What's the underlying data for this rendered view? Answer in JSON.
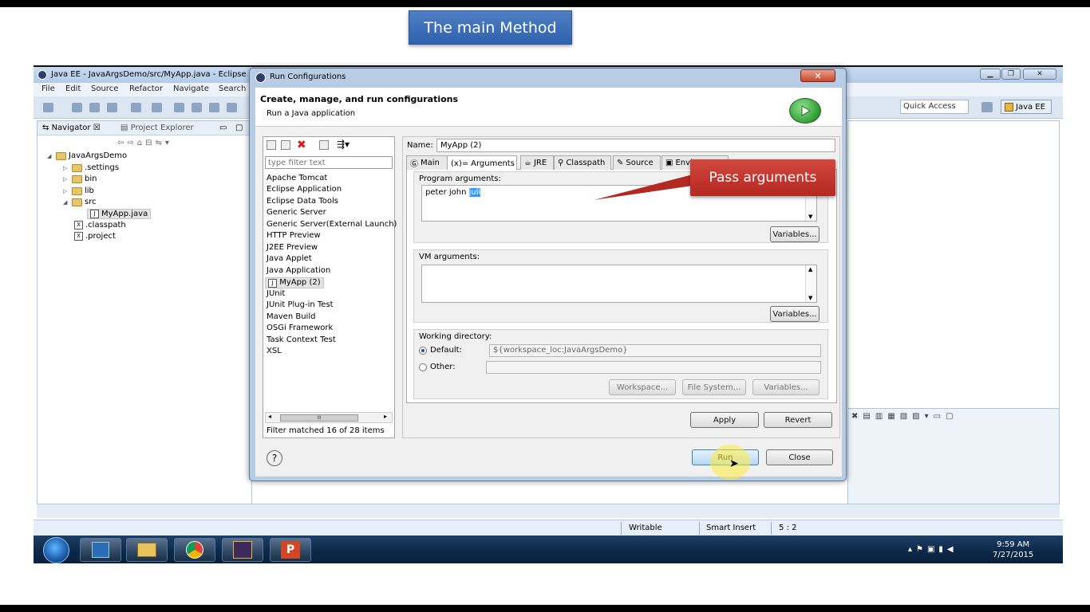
{
  "slide": {
    "title": "The main Method",
    "callout": "Pass arguments"
  },
  "eclipse": {
    "window_title": "Java EE - JavaArgsDemo/src/MyApp.java - Eclipse",
    "menu": [
      "File",
      "Edit",
      "Source",
      "Refactor",
      "Navigate",
      "Search"
    ],
    "quick_access": "Quick Access",
    "perspective": "Java EE",
    "panel_tabs": {
      "navigator": "Navigator",
      "project_explorer": "Project Explorer"
    },
    "tree": [
      {
        "label": "JavaArgsDemo"
      },
      {
        "label": ".settings"
      },
      {
        "label": "bin"
      },
      {
        "label": "lib"
      },
      {
        "label": "src"
      },
      {
        "label": "MyApp.java"
      },
      {
        "label": ".classpath"
      },
      {
        "label": ".project"
      }
    ],
    "status": {
      "writable": "Writable",
      "insert_mode": "Smart Insert",
      "position": "5 : 2"
    }
  },
  "dialog": {
    "title": "Run Configurations",
    "header_title": "Create, manage, and run configurations",
    "header_sub": "Run a Java application",
    "filter_placeholder": "type filter text",
    "configs": [
      "Apache Tomcat",
      "Eclipse Application",
      "Eclipse Data Tools",
      "Generic Server",
      "Generic Server(External Launch)",
      "HTTP Preview",
      "J2EE Preview",
      "Java Applet",
      "Java Application",
      "MyApp (2)",
      "JUnit",
      "JUnit Plug-in Test",
      "Maven Build",
      "OSGi Framework",
      "Task Context Test",
      "XSL"
    ],
    "hscroll_label": "III",
    "filter_status": "Filter matched 16 of 28 items",
    "name_label": "Name:",
    "name_value": "MyApp (2)",
    "tabs": [
      "Main",
      "Arguments",
      "JRE",
      "Classpath",
      "Source",
      "Envi"
    ],
    "tab_prefixes": {
      "arguments": "(x)="
    },
    "program_args_label": "Program arguments:",
    "program_args_plain": "peter john ",
    "program_args_selected": "juli",
    "variables_label": "Variables...",
    "vm_args_label": "VM arguments:",
    "working_dir_label": "Working directory:",
    "default_label": "Default:",
    "default_value": "${workspace_loc:JavaArgsDemo}",
    "other_label": "Other:",
    "workspace_btn": "Workspace...",
    "filesystem_btn": "File System...",
    "apply": "Apply",
    "revert": "Revert",
    "help": "?",
    "run": "Run",
    "close": "Close"
  },
  "taskbar": {
    "clock_time": "9:59 AM",
    "clock_date": "7/27/2015",
    "ppt_label": "P"
  },
  "colors": {
    "callout": "#c0322a",
    "title_blue": "#3a6db5",
    "selection": "#3399ff"
  }
}
